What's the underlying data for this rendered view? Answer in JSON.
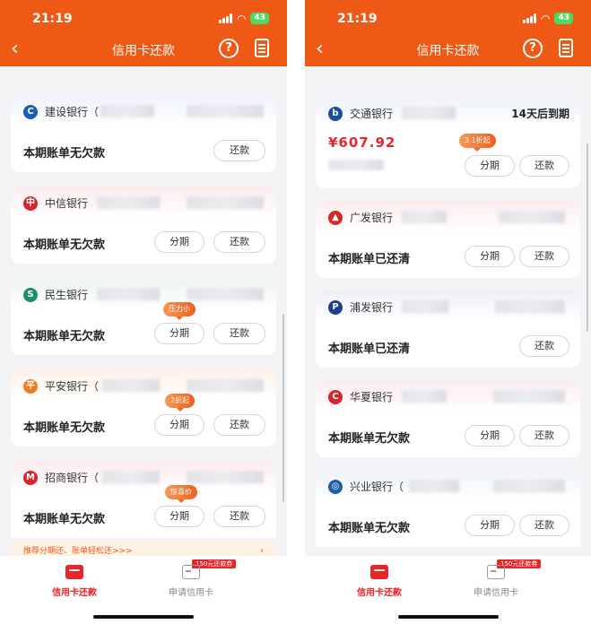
{
  "status_bar": {
    "time": "21:19",
    "battery": "43"
  },
  "nav": {
    "title": "信用卡还款",
    "back_glyph": "‹",
    "help_glyph": "?"
  },
  "left": {
    "cards": [
      {
        "bank": "建设银行（",
        "icon_color": "#1a5fb4",
        "icon_glyph": "C",
        "status": "本期账单无欠款",
        "repay": "还款"
      },
      {
        "bank": "中信银行",
        "icon_color": "#d6262b",
        "icon_glyph": "中",
        "status": "本期账单无欠款",
        "installment": "分期",
        "repay": "还款"
      },
      {
        "bank": "民生银行",
        "icon_color": "#1d8d6c",
        "icon_glyph": "S",
        "status": "本期账单无欠款",
        "tag": "压力小",
        "installment": "分期",
        "repay": "还款"
      },
      {
        "bank": "平安银行（",
        "icon_color": "#f07a1e",
        "icon_glyph": "平",
        "status": "本期账单无欠款",
        "tag": "2折起",
        "installment": "分期",
        "repay": "还款"
      },
      {
        "bank": "招商银行（",
        "icon_color": "#d6262b",
        "icon_glyph": "M",
        "status": "本期账单无欠款",
        "tag": "惊喜价",
        "installment": "分期",
        "repay": "还款"
      }
    ],
    "promo": "推荐分期还、账单轻松还>>>",
    "promo_arrow": "›"
  },
  "right": {
    "cards": [
      {
        "bank": "交通银行",
        "icon_color": "#1b4f9c",
        "icon_glyph": "b",
        "due": "14天后到期",
        "amount": "¥607.92",
        "tag": "3.1折起",
        "installment": "分期",
        "repay": "还款"
      },
      {
        "bank": "广发银行",
        "icon_color": "#d6262b",
        "icon_glyph": "▲",
        "status": "本期账单已还清",
        "installment": "分期",
        "repay": "还款"
      },
      {
        "bank": "浦发银行",
        "icon_color": "#1b3f8a",
        "icon_glyph": "P",
        "status": "本期账单已还清",
        "repay": "还款"
      },
      {
        "bank": "华夏银行",
        "icon_color": "#d6262b",
        "icon_glyph": "C",
        "status": "本期账单无欠款",
        "installment": "分期",
        "repay": "还款"
      },
      {
        "bank": "兴业银行（",
        "icon_color": "#1b5fa8",
        "icon_glyph": "◎",
        "status": "本期账单无欠款",
        "installment": "分期",
        "repay": "还款"
      }
    ]
  },
  "tabbar": {
    "tab_repay": "信用卡还款",
    "tab_apply": "申请信用卡",
    "coupon": "150元还款券"
  },
  "colors": {
    "brand": "#ee5a16",
    "accent_red": "#e8262a"
  }
}
